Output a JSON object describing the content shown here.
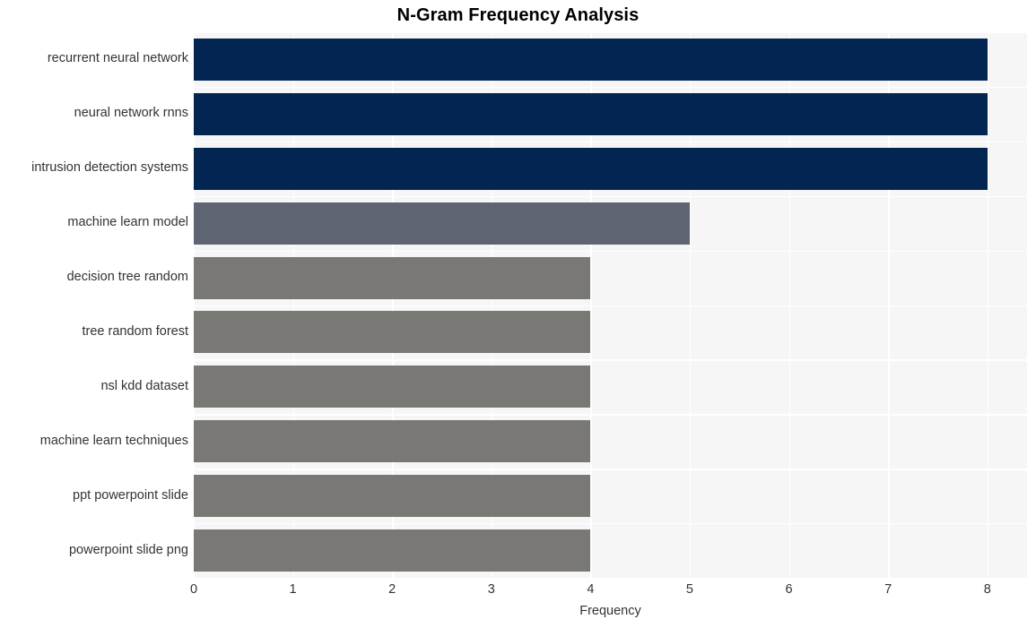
{
  "chart_data": {
    "type": "bar",
    "orientation": "horizontal",
    "title": "N-Gram Frequency Analysis",
    "xlabel": "Frequency",
    "ylabel": "",
    "xlim": [
      0,
      8.4
    ],
    "xticks": [
      "0",
      "1",
      "2",
      "3",
      "4",
      "5",
      "6",
      "7",
      "8"
    ],
    "xtick_values": [
      0,
      1,
      2,
      3,
      4,
      5,
      6,
      7,
      8
    ],
    "grid": true,
    "legend": "none",
    "categories": [
      "recurrent neural network",
      "neural network rnns",
      "intrusion detection systems",
      "machine learn model",
      "decision tree random",
      "tree random forest",
      "nsl kdd dataset",
      "machine learn techniques",
      "ppt powerpoint slide",
      "powerpoint slide png"
    ],
    "values": [
      8,
      8,
      8,
      5,
      4,
      4,
      4,
      4,
      4,
      4
    ],
    "bar_colors": [
      "#032552",
      "#032552",
      "#032552",
      "#5e6472",
      "#7a7874",
      "#7a7874",
      "#7a7874",
      "#7a7874",
      "#7a7874",
      "#7a7874"
    ],
    "plot_background": "#f6f6f7",
    "gridline_color": "#ffffff",
    "tick_label_color": "#333333",
    "title_color": "#000000"
  }
}
